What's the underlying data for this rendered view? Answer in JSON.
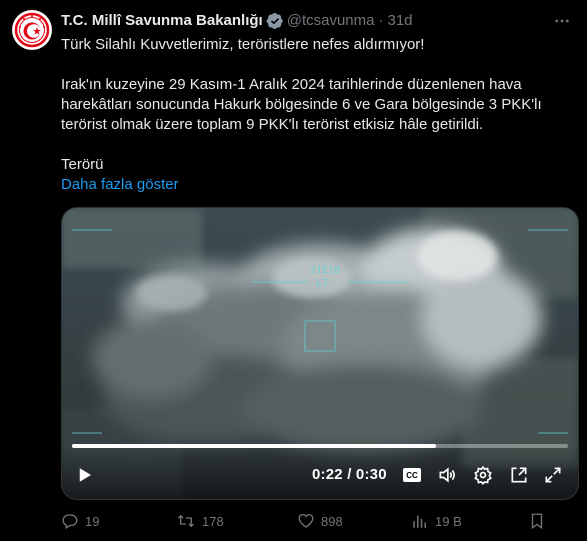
{
  "tweet": {
    "display_name": "T.C. Millî Savunma Bakanlığı",
    "handle": "@tcsavunma",
    "separator": "·",
    "time": "31d",
    "lines": [
      "Türk Silahlı Kuvvetlerimiz, teröristlere nefes aldırmıyor!",
      "Irak'ın kuzeyine 29 Kasım-1 Aralık 2024 tarihlerinde düzenlenen hava harekâtları sonucunda Hakurk bölgesinde 6 ve Gara bölgesinde 3 PKK'lı terörist olmak üzere toplam 9 PKK'lı terörist etkisiz hâle getirildi.",
      "Terörü"
    ],
    "show_more": "Daha fazla göster"
  },
  "video": {
    "hud_label": "21E18",
    "hud_sub": "L7",
    "time_readout": "0:22 / 0:30",
    "progress": 0.733,
    "cc_label": "CC"
  },
  "actions": {
    "replies": "19",
    "reposts": "178",
    "likes": "898",
    "views": "19 B"
  },
  "icons": {
    "verified": "verified-gold-badge-icon",
    "more": "more-horizontal-icon",
    "play": "play-icon",
    "volume": "volume-icon",
    "settings": "settings-gear-icon",
    "pip": "picture-in-picture-icon",
    "fullscreen": "fullscreen-icon",
    "reply": "reply-icon",
    "repost": "repost-icon",
    "like": "heart-icon",
    "views": "views-bar-chart-icon",
    "bookmark": "bookmark-icon"
  },
  "colors": {
    "link": "#1d9bf0",
    "muted": "#71767b",
    "text": "#e7e9ea",
    "verified": "#e2b719",
    "brand_red": "#e30a17"
  }
}
